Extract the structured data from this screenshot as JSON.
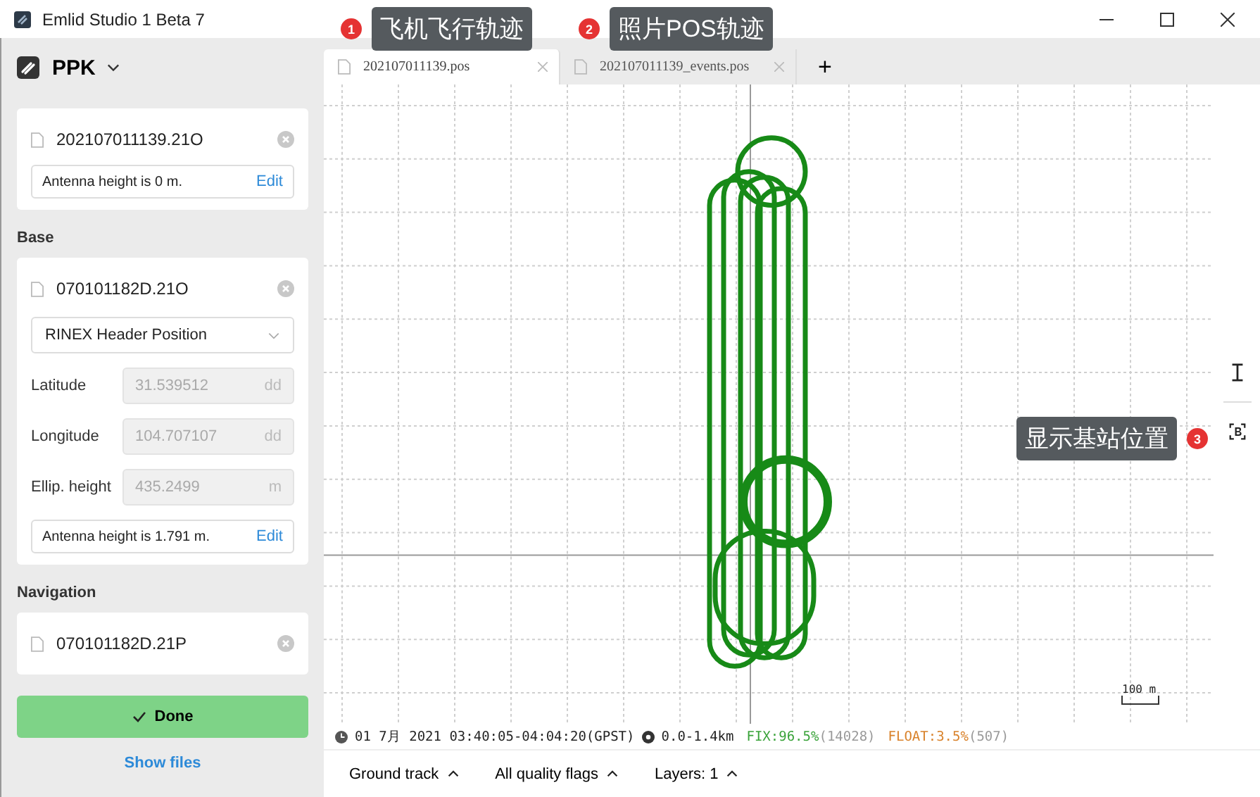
{
  "window": {
    "title": "Emlid Studio 1 Beta 7"
  },
  "sidebar": {
    "mode": "PPK",
    "rover": {
      "file": "202107011139.21O",
      "antenna": "Antenna height is 0 m.",
      "edit": "Edit"
    },
    "base": {
      "heading": "Base",
      "file": "070101182D.21O",
      "position_source": "RINEX Header Position",
      "fields": [
        {
          "label": "Latitude",
          "value": "31.539512",
          "unit": "dd"
        },
        {
          "label": "Longitude",
          "value": "104.707107",
          "unit": "dd"
        },
        {
          "label": "Ellip. height",
          "value": "435.2499",
          "unit": "m"
        }
      ],
      "antenna": "Antenna height is 1.791 m.",
      "edit": "Edit"
    },
    "navigation": {
      "heading": "Navigation",
      "file": "070101182D.21P"
    },
    "done": "Done",
    "show_files": "Show files"
  },
  "tabs": [
    {
      "label": "202107011139.pos",
      "selected": true
    },
    {
      "label": "202107011139_events.pos",
      "selected": false
    }
  ],
  "new_tab": "+",
  "map": {
    "scale": "100 m"
  },
  "status": {
    "time": "01 7月 2021 03:40:05-04:04:20(GPST)",
    "range": "0.0-1.4km",
    "fix": "FIX:96.5%",
    "fix_count": "(14028)",
    "float": "FLOAT:3.5%",
    "float_count": "(507)"
  },
  "bottom_menus": [
    {
      "label": "Ground track"
    },
    {
      "label": "All quality flags"
    },
    {
      "label": "Layers: 1"
    }
  ],
  "annotations": [
    {
      "number": "1",
      "text": "飞机飞行轨迹"
    },
    {
      "number": "2",
      "text": "照片POS轨迹"
    },
    {
      "number": "3",
      "text": "显示基站位置"
    }
  ]
}
